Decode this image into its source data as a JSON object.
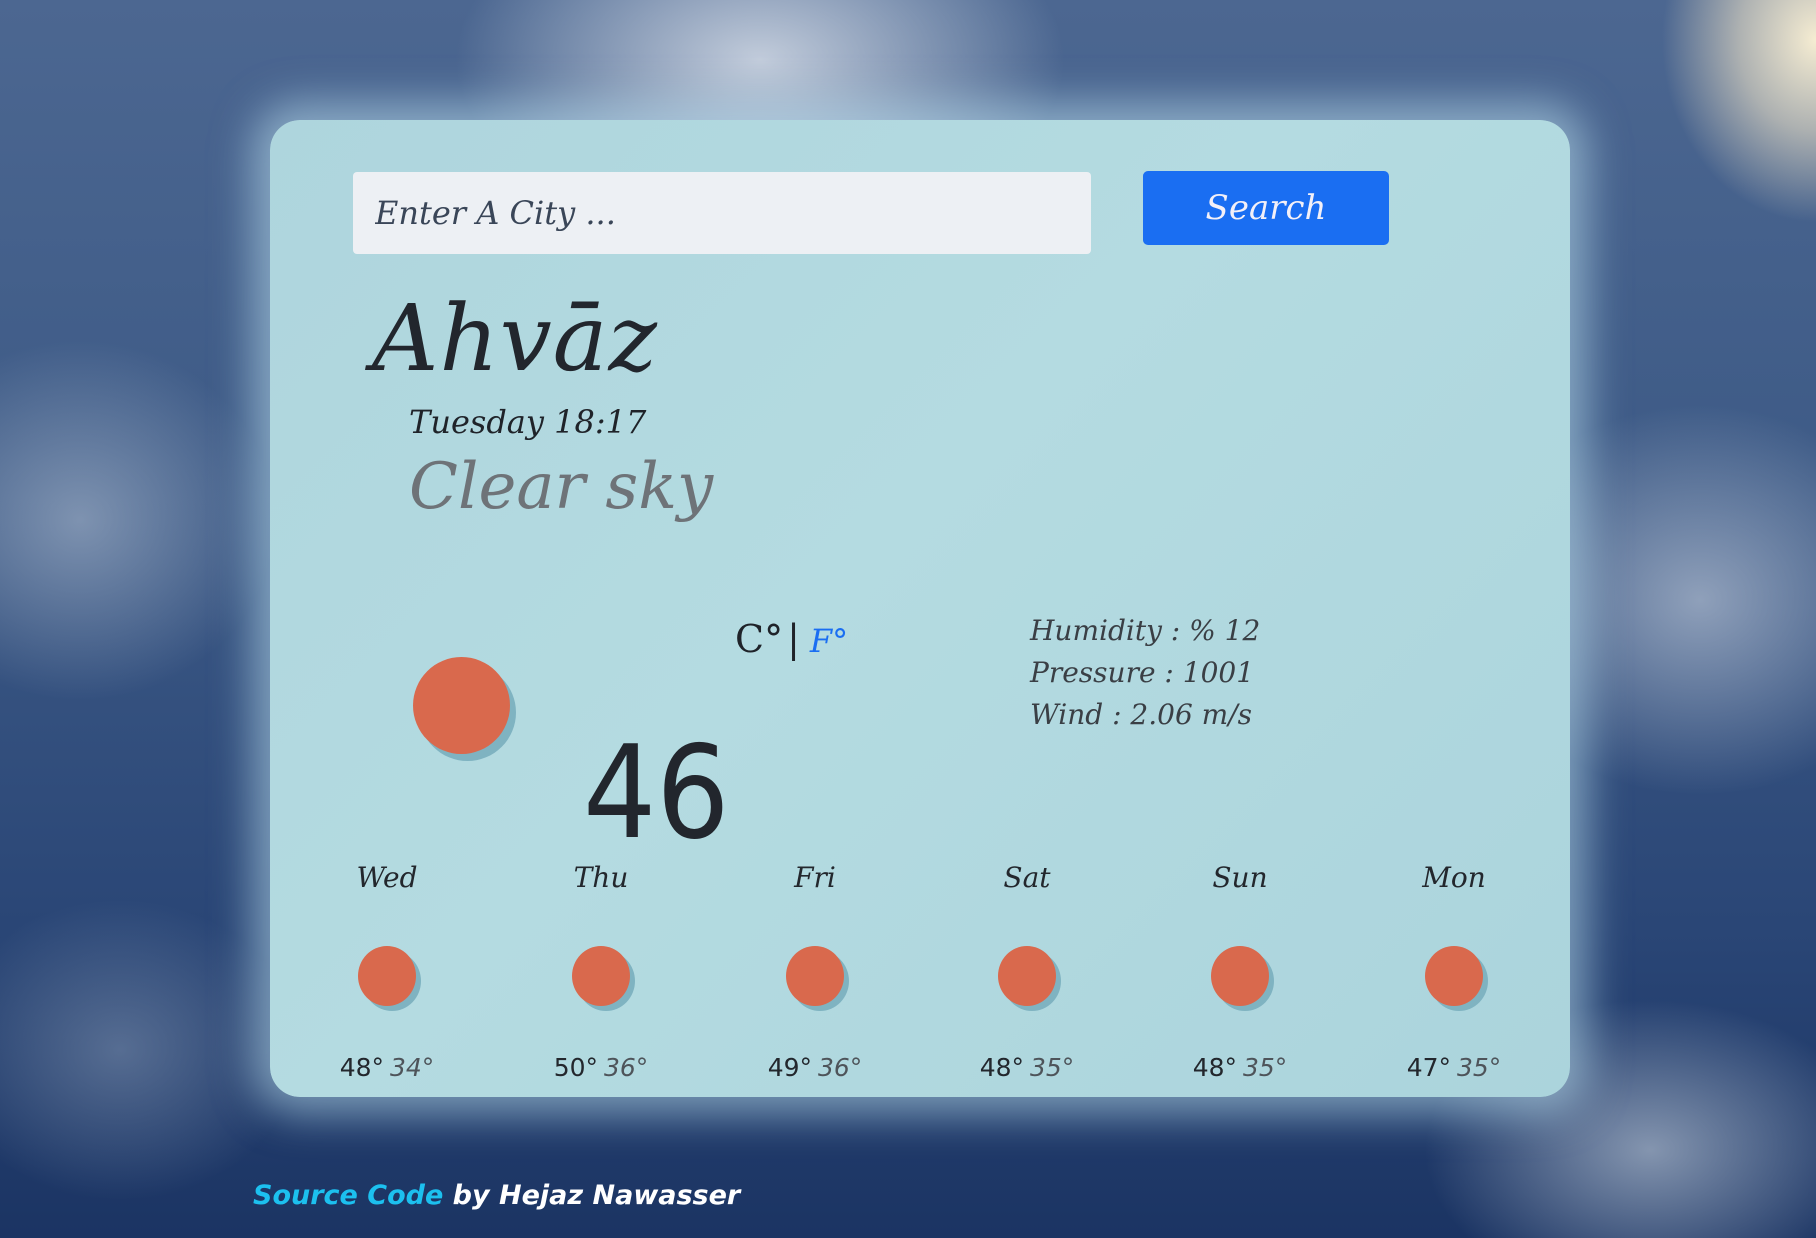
{
  "search": {
    "placeholder": "Enter A City ...",
    "value": "",
    "button_label": "Search"
  },
  "current": {
    "city": "Ahvāz",
    "datetime": "Tuesday 18:17",
    "condition": "Clear sky",
    "icon": "sun-icon",
    "temperature": "46",
    "unit_celsius": "C°",
    "unit_separator": "|",
    "unit_fahrenheit": "F°",
    "active_unit": "C"
  },
  "details": {
    "humidity": "Humidity : % 12",
    "pressure": "Pressure : 1001",
    "wind": "Wind : 2.06 m/s"
  },
  "forecast": [
    {
      "day": "Wed",
      "icon": "sun-icon",
      "high": "48°",
      "low": "34°"
    },
    {
      "day": "Thu",
      "icon": "sun-icon",
      "high": "50°",
      "low": "36°"
    },
    {
      "day": "Fri",
      "icon": "sun-icon",
      "high": "49°",
      "low": "36°"
    },
    {
      "day": "Sat",
      "icon": "sun-icon",
      "high": "48°",
      "low": "35°"
    },
    {
      "day": "Sun",
      "icon": "sun-icon",
      "high": "48°",
      "low": "35°"
    },
    {
      "day": "Mon",
      "icon": "sun-icon",
      "high": "47°",
      "low": "35°"
    }
  ],
  "footer": {
    "link_label": "Source Code",
    "credit": "by Hejaz Nawasser"
  },
  "colors": {
    "accent": "#1a6ef2",
    "sun": "#d9694d",
    "card": "#aed5dd",
    "footer_link": "#1cc0ef"
  }
}
